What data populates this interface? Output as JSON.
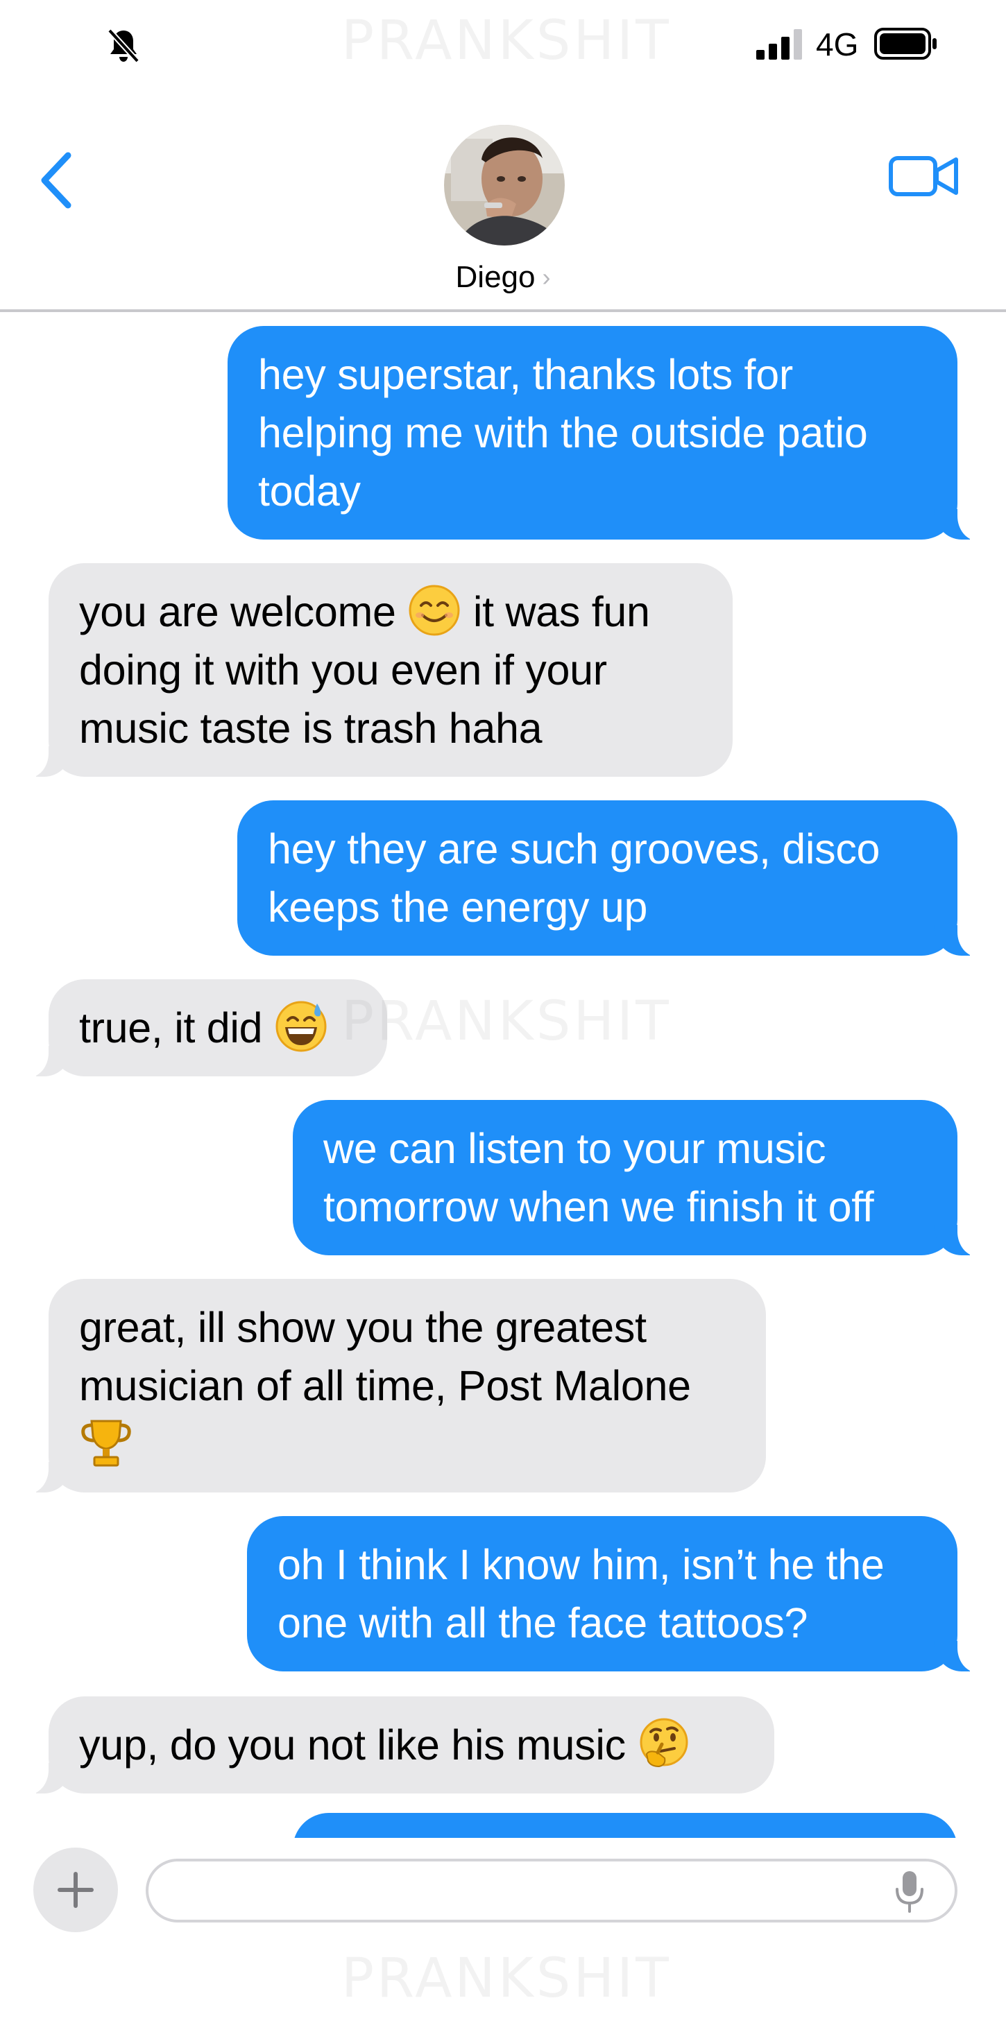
{
  "watermark": "PRANKSHIT",
  "status_bar": {
    "network": "4G",
    "icons": [
      "silent-bell-icon",
      "signal-icon",
      "battery-icon"
    ]
  },
  "header": {
    "contact_name": "Diego",
    "chevron": "›",
    "icons": [
      "back-chevron-icon",
      "video-call-icon"
    ],
    "accent_color": "#1f8ff9"
  },
  "messages": [
    {
      "side": "sent",
      "lines": [
        "hey superstar, thanks lots for",
        "helping me with the outside patio",
        "today"
      ]
    },
    {
      "side": "received",
      "lines": [
        "you are welcome",
        "it was fun",
        "doing it with you even if your",
        "music taste is trash haha"
      ],
      "emoji": "smiling-face-icon"
    },
    {
      "side": "sent",
      "lines": [
        "hey they are such grooves, disco",
        "keeps the energy up"
      ]
    },
    {
      "side": "received",
      "lines": [
        "true, it did"
      ],
      "emoji": "grinning-sweat-icon"
    },
    {
      "side": "sent",
      "lines": [
        "we can listen to your music",
        "tomorrow when we finish it off"
      ]
    },
    {
      "side": "received",
      "lines": [
        "great, ill show you the greatest",
        "musician of all time, Post Malone"
      ],
      "emoji": "trophy-icon"
    },
    {
      "side": "sent",
      "lines": [
        "oh I think I know him, isn’t he the",
        "one with all the face tattoos?"
      ]
    },
    {
      "side": "received",
      "lines": [
        "yup, do you not like his music"
      ],
      "emoji": "thinking-face-icon"
    }
  ],
  "input": {
    "value": "",
    "placeholder": "",
    "icons": [
      "plus-icon",
      "microphone-icon"
    ]
  },
  "colors": {
    "sent_bubble": "#1f8ff9",
    "received_bubble": "#e8e8ea",
    "separator": "#c8c8cc"
  }
}
